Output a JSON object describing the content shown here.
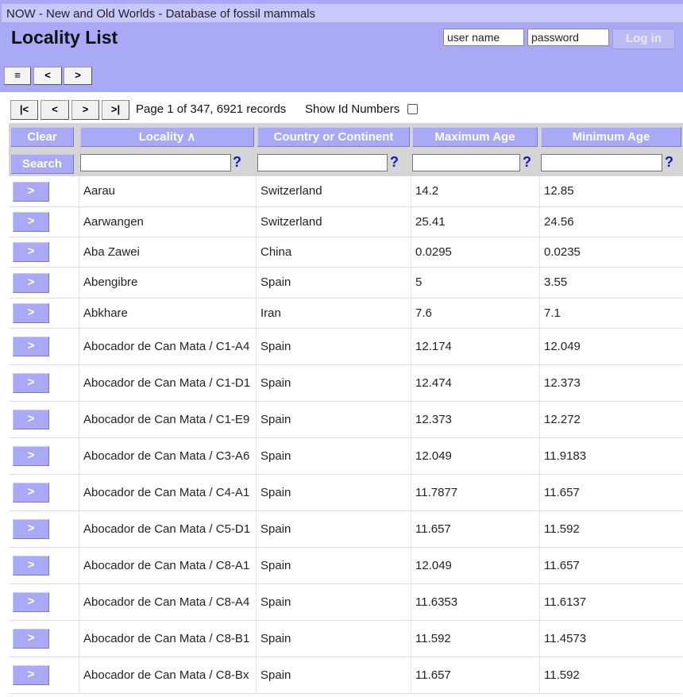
{
  "header": {
    "app_title": "NOW - New and Old Worlds - Database of fossil mammals",
    "page_title": "Locality List",
    "login": {
      "username_value": "user name",
      "password_value": "password",
      "login_label": "Log in"
    },
    "nav": {
      "menu_label": "≡",
      "back_label": "<",
      "forward_label": ">"
    }
  },
  "pager": {
    "first_label": "|<",
    "prev_label": "<",
    "next_label": ">",
    "last_label": ">|",
    "page_info": "Page 1 of 347, 6921 records",
    "show_id_label": "Show Id Numbers",
    "show_id_checked": false
  },
  "table": {
    "clear_label": "Clear",
    "search_label": "Search",
    "help_label": "?",
    "columns": [
      "Locality ∧",
      "Country or Continent",
      "Maximum Age",
      "Minimum Age"
    ],
    "row_button_label": ">",
    "rows": [
      {
        "locality": "Aarau",
        "country": "Switzerland",
        "max_age": "14.2",
        "min_age": "12.85"
      },
      {
        "locality": "Aarwangen",
        "country": "Switzerland",
        "max_age": "25.41",
        "min_age": "24.56"
      },
      {
        "locality": "Aba Zawei",
        "country": "China",
        "max_age": "0.0295",
        "min_age": "0.0235"
      },
      {
        "locality": "Abengibre",
        "country": "Spain",
        "max_age": "5",
        "min_age": "3.55"
      },
      {
        "locality": "Abkhare",
        "country": "Iran",
        "max_age": "7.6",
        "min_age": "7.1"
      },
      {
        "locality": "Abocador de Can Mata / C1-A4",
        "country": "Spain",
        "max_age": "12.174",
        "min_age": "12.049"
      },
      {
        "locality": "Abocador de Can Mata / C1-D1",
        "country": "Spain",
        "max_age": "12.474",
        "min_age": "12.373"
      },
      {
        "locality": "Abocador de Can Mata / C1-E9",
        "country": "Spain",
        "max_age": "12.373",
        "min_age": "12.272"
      },
      {
        "locality": "Abocador de Can Mata / C3-A6",
        "country": "Spain",
        "max_age": "12.049",
        "min_age": "11.9183"
      },
      {
        "locality": "Abocador de Can Mata / C4-A1",
        "country": "Spain",
        "max_age": "11.7877",
        "min_age": "11.657"
      },
      {
        "locality": "Abocador de Can Mata / C5-D1",
        "country": "Spain",
        "max_age": "11.657",
        "min_age": "11.592"
      },
      {
        "locality": "Abocador de Can Mata / C8-A1",
        "country": "Spain",
        "max_age": "12.049",
        "min_age": "11.657"
      },
      {
        "locality": "Abocador de Can Mata / C8-A4",
        "country": "Spain",
        "max_age": "11.6353",
        "min_age": "11.6137"
      },
      {
        "locality": "Abocador de Can Mata / C8-B1",
        "country": "Spain",
        "max_age": "11.592",
        "min_age": "11.4573"
      },
      {
        "locality": "Abocador de Can Mata / C8-Bx",
        "country": "Spain",
        "max_age": "11.657",
        "min_age": "11.592"
      }
    ]
  }
}
